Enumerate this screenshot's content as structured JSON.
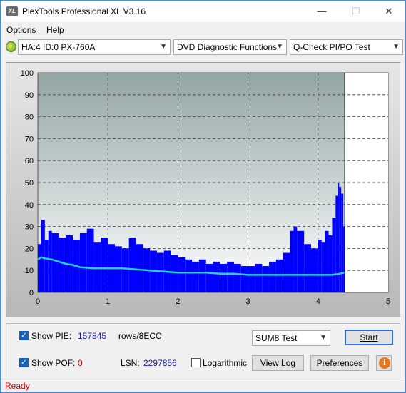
{
  "window": {
    "title": "PlexTools Professional XL V3.16",
    "app_icon_text": "XL",
    "minimize": "—",
    "maximize": "☐",
    "close": "✕"
  },
  "menu": {
    "options": "ptions",
    "options_underlined": "O",
    "help": "elp",
    "help_underlined": "H"
  },
  "toolbar": {
    "drive": "HA:4 ID:0  PX-760A",
    "function": "DVD Diagnostic Functions",
    "test": "Q-Check PI/PO Test"
  },
  "chart_data": {
    "type": "area",
    "title": "",
    "xlabel": "",
    "ylabel": "",
    "xlim": [
      0,
      5
    ],
    "ylim": [
      0,
      100
    ],
    "x_ticks": [
      "0",
      "1",
      "2",
      "3",
      "4",
      "5"
    ],
    "y_ticks": [
      "0",
      "10",
      "20",
      "30",
      "40",
      "50",
      "60",
      "70",
      "80",
      "90",
      "100"
    ],
    "grid": true,
    "end_marker_x": 4.38,
    "series": [
      {
        "name": "",
        "color": "#0000ff",
        "kind": "bars",
        "x": [
          0.0,
          0.05,
          0.1,
          0.15,
          0.2,
          0.3,
          0.4,
          0.5,
          0.6,
          0.7,
          0.8,
          0.9,
          1.0,
          1.1,
          1.2,
          1.3,
          1.4,
          1.5,
          1.6,
          1.7,
          1.8,
          1.9,
          2.0,
          2.1,
          2.2,
          2.3,
          2.4,
          2.5,
          2.6,
          2.7,
          2.8,
          2.9,
          3.0,
          3.1,
          3.2,
          3.3,
          3.4,
          3.5,
          3.6,
          3.65,
          3.7,
          3.8,
          3.9,
          4.0,
          4.05,
          4.1,
          4.15,
          4.2,
          4.25,
          4.28,
          4.3,
          4.33,
          4.36
        ],
        "y": [
          22,
          33,
          24,
          28,
          27,
          25,
          26,
          24,
          27,
          29,
          23,
          25,
          22,
          21,
          20,
          25,
          22,
          20,
          19,
          18,
          19,
          17,
          16,
          15,
          14,
          15,
          13,
          14,
          13,
          14,
          13,
          12,
          12,
          13,
          12,
          14,
          15,
          18,
          28,
          30,
          28,
          22,
          20,
          24,
          23,
          28,
          26,
          34,
          44,
          50,
          48,
          45,
          30
        ]
      },
      {
        "name": "",
        "color": "#22d3d3",
        "kind": "line",
        "x": [
          0.0,
          0.05,
          0.1,
          0.2,
          0.3,
          0.4,
          0.5,
          0.6,
          0.8,
          1.0,
          1.2,
          1.4,
          1.6,
          1.8,
          2.0,
          2.2,
          2.4,
          2.6,
          2.8,
          3.0,
          3.2,
          3.4,
          3.6,
          3.8,
          4.0,
          4.2,
          4.3,
          4.38
        ],
        "y": [
          15,
          16,
          15.5,
          15,
          14,
          13,
          12.5,
          11.5,
          11,
          11,
          11,
          10.5,
          10,
          9.5,
          9,
          9,
          9,
          8.5,
          8.5,
          8,
          8,
          8,
          8,
          8,
          8,
          8,
          8.5,
          9
        ]
      }
    ]
  },
  "controls": {
    "show_pie_label": "Show PIE:",
    "pie_value": "157845",
    "rows_label": "rows/8ECC",
    "show_pof_label": "Show POF:",
    "pof_value": "0",
    "lsn_label": "LSN:",
    "lsn_value": "2297856",
    "logarithmic_label": "Logarithmic",
    "test_select": "SUM8 Test",
    "start": "Start",
    "view_log": "View Log",
    "preferences": "Preferences",
    "info_icon": "i"
  },
  "status": {
    "text": "Ready"
  }
}
